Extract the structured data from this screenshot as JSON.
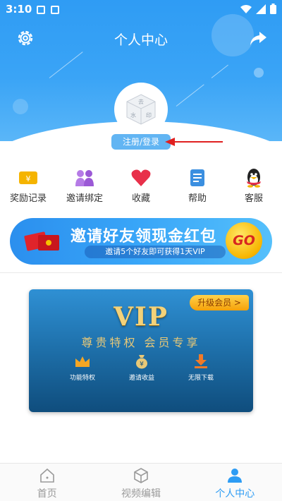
{
  "status_bar": {
    "time": "3:10"
  },
  "header": {
    "title": "个人中心"
  },
  "profile": {
    "login_label": "注册/登录",
    "avatar_watermark": [
      "去",
      "水",
      "印"
    ]
  },
  "shortcuts": [
    {
      "label": "奖励记录",
      "icon": "ticket-icon",
      "color": "#f5b400"
    },
    {
      "label": "邀请绑定",
      "icon": "invite-icon",
      "color": "#9b59d6"
    },
    {
      "label": "收藏",
      "icon": "heart-icon",
      "color": "#e8304a"
    },
    {
      "label": "帮助",
      "icon": "help-doc-icon",
      "color": "#3b8fe0"
    },
    {
      "label": "客服",
      "icon": "qq-penguin-icon",
      "color": "#222222"
    }
  ],
  "invite_banner": {
    "title": "邀请好友领现金红包",
    "subtitle": "邀请5个好友即可获得1天VIP",
    "go_label": "GO"
  },
  "vip_card": {
    "badge": "VIP",
    "slogan": "尊贵特权  会员专享",
    "upgrade_label": "升级会员 >",
    "perks": [
      {
        "label": "功能特权",
        "icon": "crown-icon"
      },
      {
        "label": "邀请收益",
        "icon": "money-bag-icon"
      },
      {
        "label": "无限下载",
        "icon": "download-icon"
      }
    ]
  },
  "bottom_nav": [
    {
      "label": "首页",
      "icon": "home-icon",
      "active": false
    },
    {
      "label": "视频编辑",
      "icon": "cube-icon",
      "active": false
    },
    {
      "label": "个人中心",
      "icon": "person-icon",
      "active": true
    }
  ],
  "colors": {
    "primary": "#2d9cf4",
    "banner_blue": "#39a6f8",
    "vip_gold": "#f3d27a",
    "arrow_red": "#e02020"
  }
}
